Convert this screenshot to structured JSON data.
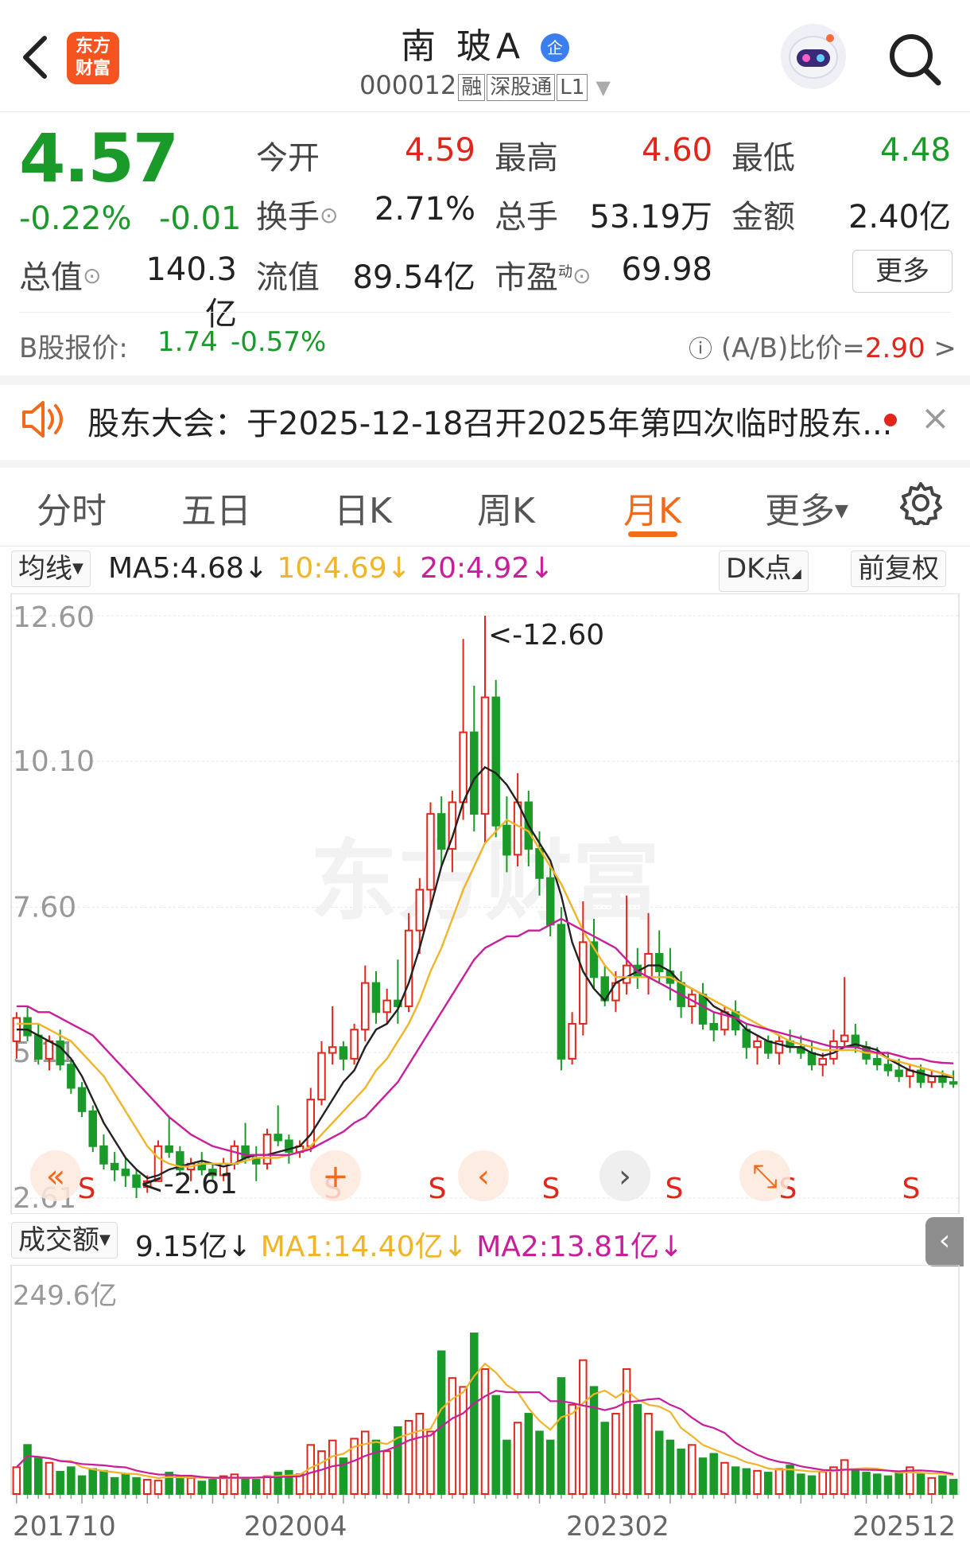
{
  "header": {
    "logo_line1": "东方",
    "logo_line2": "财富",
    "stock_name": "南  玻A",
    "name_badge": "企",
    "stock_code": "000012",
    "tags": [
      "融",
      "深股通",
      "L1"
    ]
  },
  "quote": {
    "price": "4.57",
    "change_pct": "-0.22%",
    "change_abs": "-0.01",
    "open_label": "今开",
    "open": "4.59",
    "high_label": "最高",
    "high": "4.60",
    "low_label": "最低",
    "low": "4.48",
    "turnover_label": "换手",
    "turnover": "2.71%",
    "volume_label": "总手",
    "volume": "53.19万",
    "amount_label": "金额",
    "amount": "2.40亿",
    "mktcap_label": "总值",
    "mktcap": "140.3亿",
    "float_label": "流值",
    "float": "89.54亿",
    "pe_label": "市盈",
    "pe_sup": "动",
    "pe": "69.98",
    "more_label": "更多"
  },
  "b_share": {
    "label": "B股报价:",
    "price": "1.74",
    "change": "-0.57%",
    "ratio_label": "(A/B)比价=",
    "ratio": "2.90",
    "arrow": ">"
  },
  "notice": {
    "text": "股东大会：于2025-12-18召开2025年第四次临时股东...",
    "close": "×"
  },
  "tabs": [
    "分时",
    "五日",
    "日K",
    "周K",
    "月K",
    "更多"
  ],
  "active_tab": "月K",
  "ma_bar": {
    "selector": "均线",
    "ma5": "MA5:4.68",
    "ma10": "10:4.69",
    "ma20": "20:4.92",
    "dk_label": "DK点",
    "adj_label": "前复权"
  },
  "vol_bar": {
    "selector": "成交额",
    "value": "9.15亿",
    "ma1": "MA1:14.40亿",
    "ma2": "MA2:13.81亿"
  },
  "colors": {
    "up": "#e0261b",
    "down": "#1a9a28",
    "ma5": "#222222",
    "ma10": "#f0b429",
    "ma20": "#c81e9b",
    "accent": "#f26a1b"
  },
  "icons": [
    "back-icon",
    "search-icon",
    "robot-avatar-icon",
    "speaker-icon",
    "settings-gear-icon",
    "help-circle-icon",
    "info-circle-icon",
    "fast-backward-icon",
    "zoom-in-icon",
    "prev-icon",
    "next-icon",
    "fullscreen-icon",
    "collapse-left-icon"
  ],
  "chart_data": {
    "type": "candlestick",
    "period": "monthly",
    "price_axis_labels": [
      "12.60",
      "10.10",
      "7.60",
      "5.11",
      "2.61"
    ],
    "max_label": "<-12.60",
    "min_label": "<-2.61",
    "sell_markers": [
      "S",
      "S",
      "S",
      "S",
      "S",
      "S",
      "S"
    ],
    "x_axis_labels": [
      "201710",
      "202004",
      "202302",
      "202512"
    ],
    "volume_axis_label": "249.6亿",
    "ohlc": [
      [
        5.3,
        5.8,
        5.0,
        5.7
      ],
      [
        5.7,
        5.9,
        5.3,
        5.4
      ],
      [
        5.4,
        5.6,
        4.9,
        5.0
      ],
      [
        5.0,
        5.4,
        4.8,
        5.3
      ],
      [
        5.3,
        5.5,
        4.8,
        4.9
      ],
      [
        4.9,
        5.0,
        4.4,
        4.5
      ],
      [
        4.5,
        4.6,
        4.0,
        4.1
      ],
      [
        4.1,
        4.2,
        3.4,
        3.5
      ],
      [
        3.5,
        3.7,
        3.1,
        3.2
      ],
      [
        3.2,
        3.4,
        2.9,
        3.1
      ],
      [
        3.1,
        3.3,
        2.8,
        3.0
      ],
      [
        3.0,
        3.1,
        2.61,
        2.8
      ],
      [
        2.8,
        3.0,
        2.7,
        2.9
      ],
      [
        2.9,
        3.6,
        2.9,
        3.5
      ],
      [
        3.5,
        4.0,
        3.3,
        3.4
      ],
      [
        3.4,
        3.5,
        3.0,
        3.1
      ],
      [
        3.1,
        3.3,
        2.9,
        3.2
      ],
      [
        3.2,
        3.4,
        3.0,
        3.1
      ],
      [
        3.1,
        3.2,
        2.9,
        3.0
      ],
      [
        3.0,
        3.3,
        2.9,
        3.2
      ],
      [
        3.2,
        3.6,
        3.1,
        3.5
      ],
      [
        3.5,
        3.9,
        3.2,
        3.3
      ],
      [
        3.3,
        3.5,
        2.9,
        3.2
      ],
      [
        3.2,
        3.8,
        3.1,
        3.7
      ],
      [
        3.7,
        4.2,
        3.5,
        3.6
      ],
      [
        3.6,
        3.7,
        3.2,
        3.4
      ],
      [
        3.4,
        3.6,
        3.3,
        3.5
      ],
      [
        3.5,
        4.5,
        3.4,
        4.3
      ],
      [
        4.3,
        5.3,
        4.2,
        5.1
      ],
      [
        5.1,
        5.9,
        4.9,
        5.2
      ],
      [
        5.2,
        5.3,
        4.8,
        5.0
      ],
      [
        5.0,
        5.6,
        4.9,
        5.5
      ],
      [
        5.5,
        6.6,
        5.3,
        6.3
      ],
      [
        6.3,
        6.5,
        5.6,
        5.8
      ],
      [
        5.8,
        6.2,
        5.6,
        6.0
      ],
      [
        6.0,
        6.7,
        5.6,
        5.9
      ],
      [
        5.9,
        7.5,
        5.8,
        7.2
      ],
      [
        7.2,
        8.1,
        6.8,
        7.9
      ],
      [
        7.9,
        9.4,
        7.6,
        9.2
      ],
      [
        9.2,
        9.5,
        8.3,
        8.6
      ],
      [
        8.6,
        9.6,
        8.2,
        9.4
      ],
      [
        9.4,
        12.2,
        9.1,
        10.6
      ],
      [
        10.6,
        11.4,
        8.9,
        9.2
      ],
      [
        9.2,
        12.6,
        8.7,
        11.2
      ],
      [
        11.2,
        11.5,
        8.8,
        9.0
      ],
      [
        9.0,
        9.5,
        8.2,
        8.5
      ],
      [
        8.5,
        9.9,
        8.3,
        9.4
      ],
      [
        9.4,
        9.6,
        8.3,
        8.6
      ],
      [
        8.6,
        8.9,
        7.8,
        8.1
      ],
      [
        8.1,
        8.3,
        7.1,
        7.3
      ],
      [
        7.3,
        7.6,
        4.8,
        5.0
      ],
      [
        5.0,
        5.8,
        4.9,
        5.6
      ],
      [
        5.6,
        7.7,
        5.4,
        7.0
      ],
      [
        7.0,
        7.4,
        6.2,
        6.4
      ],
      [
        6.4,
        6.6,
        5.9,
        6.0
      ],
      [
        6.0,
        6.5,
        5.8,
        6.3
      ],
      [
        6.3,
        7.8,
        6.1,
        6.6
      ],
      [
        6.6,
        6.9,
        6.2,
        6.4
      ],
      [
        6.4,
        7.5,
        6.1,
        6.8
      ],
      [
        6.8,
        7.2,
        6.3,
        6.5
      ],
      [
        6.5,
        6.9,
        6.0,
        6.3
      ],
      [
        6.3,
        6.5,
        5.7,
        5.9
      ],
      [
        5.9,
        6.2,
        5.6,
        6.1
      ],
      [
        6.1,
        6.3,
        5.5,
        5.6
      ],
      [
        5.6,
        5.8,
        5.3,
        5.5
      ],
      [
        5.5,
        5.9,
        5.4,
        5.8
      ],
      [
        5.8,
        6.0,
        5.4,
        5.5
      ],
      [
        5.5,
        5.6,
        5.0,
        5.2
      ],
      [
        5.2,
        5.4,
        4.9,
        5.3
      ],
      [
        5.3,
        5.4,
        5.0,
        5.1
      ],
      [
        5.1,
        5.4,
        4.9,
        5.3
      ],
      [
        5.3,
        5.5,
        5.1,
        5.2
      ],
      [
        5.2,
        5.4,
        5.0,
        5.1
      ],
      [
        5.1,
        5.3,
        4.8,
        4.9
      ],
      [
        4.9,
        5.1,
        4.7,
        5.0
      ],
      [
        5.0,
        5.5,
        4.9,
        5.3
      ],
      [
        5.3,
        6.4,
        5.2,
        5.4
      ],
      [
        5.4,
        5.6,
        5.1,
        5.2
      ],
      [
        5.2,
        5.3,
        4.9,
        5.0
      ],
      [
        5.0,
        5.2,
        4.8,
        4.9
      ],
      [
        4.9,
        5.1,
        4.7,
        4.8
      ],
      [
        4.8,
        5.0,
        4.6,
        4.7
      ],
      [
        4.7,
        4.9,
        4.5,
        4.8
      ],
      [
        4.8,
        4.9,
        4.5,
        4.6
      ],
      [
        4.6,
        4.8,
        4.5,
        4.7
      ],
      [
        4.7,
        4.8,
        4.5,
        4.6
      ],
      [
        4.6,
        4.8,
        4.5,
        4.57
      ]
    ],
    "volume": [
      30,
      55,
      40,
      35,
      25,
      30,
      20,
      28,
      26,
      18,
      22,
      18,
      16,
      15,
      24,
      20,
      18,
      14,
      16,
      20,
      22,
      18,
      16,
      20,
      24,
      26,
      22,
      55,
      48,
      60,
      40,
      62,
      70,
      60,
      48,
      75,
      82,
      90,
      70,
      160,
      130,
      120,
      180,
      140,
      110,
      60,
      80,
      90,
      70,
      60,
      130,
      100,
      150,
      120,
      80,
      90,
      140,
      100,
      90,
      70,
      60,
      50,
      55,
      40,
      45,
      35,
      30,
      28,
      26,
      24,
      28,
      32,
      22,
      20,
      25,
      30,
      38,
      28,
      24,
      22,
      20,
      25,
      30,
      22,
      18,
      20,
      16
    ],
    "ma5": [
      5.5,
      5.5,
      5.4,
      5.3,
      5.2,
      5.0,
      4.7,
      4.3,
      3.9,
      3.6,
      3.3,
      3.1,
      2.95,
      3.0,
      3.1,
      3.15,
      3.2,
      3.25,
      3.2,
      3.15,
      3.2,
      3.3,
      3.35,
      3.35,
      3.4,
      3.45,
      3.5,
      3.7,
      4.0,
      4.3,
      4.6,
      4.8,
      5.2,
      5.5,
      5.6,
      5.85,
      6.3,
      6.9,
      7.6,
      8.3,
      8.8,
      9.4,
      9.8,
      10.0,
      9.9,
      9.7,
      9.4,
      9.0,
      8.7,
      8.4,
      7.8,
      7.0,
      6.5,
      6.2,
      6.0,
      6.3,
      6.4,
      6.5,
      6.6,
      6.6,
      6.5,
      6.3,
      6.2,
      6.1,
      5.9,
      5.8,
      5.7,
      5.5,
      5.4,
      5.3,
      5.25,
      5.2,
      5.2,
      5.1,
      5.05,
      5.1,
      5.2,
      5.25,
      5.2,
      5.15,
      5.0,
      4.9,
      4.8,
      4.75,
      4.7,
      4.7,
      4.68
    ],
    "ma10": [
      5.6,
      5.6,
      5.6,
      5.5,
      5.4,
      5.3,
      5.1,
      4.9,
      4.7,
      4.4,
      4.1,
      3.8,
      3.5,
      3.3,
      3.2,
      3.15,
      3.15,
      3.2,
      3.2,
      3.2,
      3.2,
      3.25,
      3.3,
      3.3,
      3.3,
      3.35,
      3.4,
      3.5,
      3.7,
      3.9,
      4.1,
      4.3,
      4.5,
      4.8,
      5.0,
      5.3,
      5.6,
      6.0,
      6.5,
      6.9,
      7.4,
      7.9,
      8.3,
      8.7,
      8.9,
      9.1,
      9.0,
      8.9,
      8.6,
      8.3,
      8.0,
      7.6,
      7.2,
      6.9,
      6.6,
      6.4,
      6.4,
      6.4,
      6.4,
      6.4,
      6.4,
      6.3,
      6.2,
      6.1,
      6.0,
      5.9,
      5.8,
      5.7,
      5.6,
      5.5,
      5.4,
      5.3,
      5.25,
      5.2,
      5.15,
      5.15,
      5.15,
      5.15,
      5.1,
      5.1,
      5.0,
      4.95,
      4.9,
      4.85,
      4.8,
      4.75,
      4.69
    ],
    "ma20": [
      5.9,
      5.9,
      5.8,
      5.8,
      5.7,
      5.6,
      5.5,
      5.4,
      5.2,
      5.0,
      4.8,
      4.6,
      4.4,
      4.2,
      4.0,
      3.85,
      3.7,
      3.6,
      3.5,
      3.45,
      3.4,
      3.35,
      3.35,
      3.35,
      3.35,
      3.35,
      3.4,
      3.45,
      3.55,
      3.65,
      3.75,
      3.9,
      4.0,
      4.2,
      4.4,
      4.6,
      4.9,
      5.2,
      5.5,
      5.8,
      6.1,
      6.4,
      6.7,
      6.9,
      7.0,
      7.1,
      7.1,
      7.2,
      7.2,
      7.3,
      7.4,
      7.3,
      7.2,
      7.1,
      7.0,
      6.9,
      6.7,
      6.5,
      6.4,
      6.3,
      6.2,
      6.1,
      6.0,
      5.9,
      5.8,
      5.75,
      5.7,
      5.6,
      5.55,
      5.5,
      5.45,
      5.4,
      5.35,
      5.3,
      5.25,
      5.2,
      5.2,
      5.2,
      5.15,
      5.1,
      5.1,
      5.05,
      5.0,
      5.0,
      4.95,
      4.93,
      4.92
    ]
  }
}
